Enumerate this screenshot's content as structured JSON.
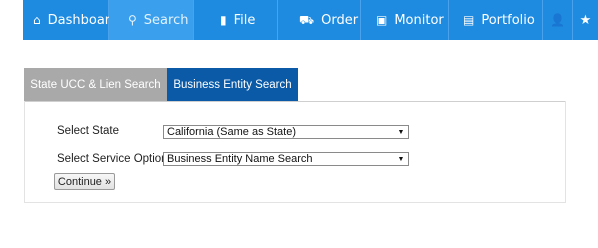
{
  "nav": {
    "items": [
      {
        "label": "Dashboard",
        "icon": "home-icon",
        "glyph": "⌂"
      },
      {
        "label": "Search",
        "icon": "search-icon",
        "glyph": "⚲",
        "active": true
      },
      {
        "label": "File",
        "icon": "file-icon",
        "glyph": "▮"
      },
      {
        "label": "Order",
        "icon": "cart-icon",
        "glyph": "⛟"
      },
      {
        "label": "Monitor",
        "icon": "monitor-icon",
        "glyph": "▣"
      },
      {
        "label": "Portfolio",
        "icon": "portfolio-icon",
        "glyph": "▤"
      },
      {
        "label": "",
        "icon": "user-icon",
        "glyph": "👤"
      },
      {
        "label": "",
        "icon": "star-icon",
        "glyph": "★"
      }
    ]
  },
  "tabs": {
    "ucc": "State UCC & Lien Search",
    "business": "Business Entity Search"
  },
  "form": {
    "state_label": "Select State",
    "state_value": "California (Same as State)",
    "service_label": "Select Service Option",
    "service_value": "Business Entity Name Search",
    "arrow": "▼",
    "continue_label": "Continue »"
  },
  "colors": {
    "nav_bg": "#1e8be0",
    "nav_active": "#3aa0ee",
    "tab_inactive": "#a9a9a9",
    "tab_active": "#0a5aa8"
  }
}
